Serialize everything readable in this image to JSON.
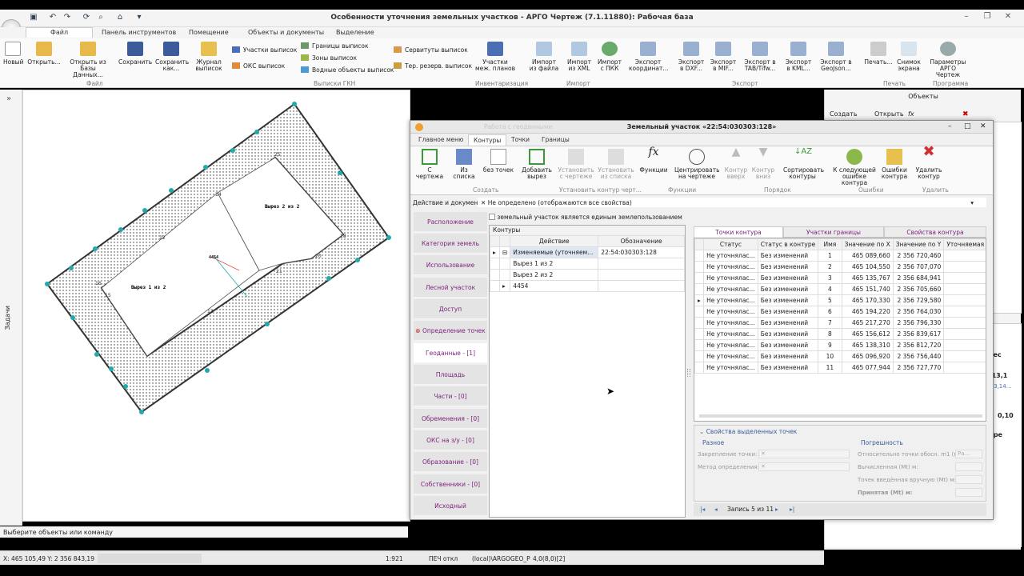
{
  "app": {
    "title": "Особенности уточнения земельных участков - АРГО Чертеж (7.1.11880): Рабочая база"
  },
  "ribbon": {
    "tabs": [
      "Файл",
      "Панель инструментов",
      "Помещение",
      "Объекты и документы",
      "Выделение"
    ],
    "buttons": {
      "new": "Новый",
      "open": "Открыть...",
      "open_db": "Открыть из Базы Данных...",
      "save": "Сохранить",
      "save_as": "Сохранить как...",
      "journal": "Журнал выписок",
      "plans": "Участки меж. планов",
      "import_file": "Импорт из файла",
      "import_xml": "Импорт из XML",
      "import_pkk": "Импорт с ПКК",
      "exp_coord": "Экспорт координат...",
      "exp_dxf": "Экспорт в DXF...",
      "exp_mif": "Экспорт в MIF...",
      "exp_tab": "Экспорт в TAB/Tifw...",
      "exp_kml": "Экспорт в KML...",
      "exp_geojson": "Экспорт в GeoJson...",
      "print": "Печать...",
      "snapshot": "Снимок экрана",
      "params": "Параметры АРГО Чертеж"
    },
    "small": {
      "parcels": "Участки выписок",
      "oks": "ОКС выписок",
      "borders": "Границы выписок",
      "zones": "Зоны выписок",
      "water": "Водные объекты выписок",
      "servitudes": "Сервитуты выписок",
      "reserves": "Тер. резерв. выписок"
    },
    "groups": [
      "Файл",
      "Выписки ГКН",
      "Инвентаризация",
      "Импорт",
      "Экспорт",
      "Печать",
      "Программа"
    ]
  },
  "left_strip": {
    "label": "Задачи"
  },
  "canvas": {
    "label_cut1": "Вырез 1 из 2",
    "label_cut2": "Вырез 2 из 2",
    "label_center": "4454",
    "point_labels": [
      "12",
      "13",
      "14",
      "15",
      "16",
      "18",
      "20",
      "21",
      "25"
    ]
  },
  "status": {
    "prompt": "Выберите объекты или команду",
    "coords": "X: 465 105,49 Y: 2 356 843,19",
    "scale": "1:921",
    "print": "ПЕЧ откл",
    "db": "(local)\\ARGOGEO_P",
    "zoom": "4,0(8,0)[2]"
  },
  "objects_panel": {
    "title": "Объекты",
    "create": "Создать",
    "open": "Открыть",
    "fx": "fx",
    "partial_texts": [
      "квес",
      "1,13,1",
      "1,13,14...",
      "0,10",
      "акре"
    ]
  },
  "dialog": {
    "title": "Земельный участок «22:54:030303:128»",
    "faded_title": "Работа с геоданными",
    "tabs": [
      "Главное меню",
      "Контуры",
      "Точки",
      "Границы"
    ],
    "buttons": {
      "from_drawing": "С чертежа",
      "from_list": "Из списка",
      "no_points": "без точек",
      "add_cut": "Добавить вырез",
      "set_from_drawing": "Установить с чертеже",
      "set_from_list": "Установить из списка",
      "functions": "Функции",
      "center": "Центрировать на чертеже",
      "up": "Контур вверх",
      "down": "Контур вниз",
      "sort": "Сортировать контуры",
      "next_error": "К следующей ошибке контура",
      "errors": "Ошибки контура",
      "delete": "Удалить контур"
    },
    "groups": [
      "Создать",
      "Установить контур черт...",
      "Функции",
      "Порядок",
      "Ошибки",
      "Удалить"
    ],
    "action_label": "Действие и документ:",
    "action_value": "Не определено (отображаются все свойства)",
    "checkbox_label": "земельный участок является единым землепользованием",
    "nav": [
      "Расположение",
      "Категория земель",
      "Использование",
      "Лесной участок",
      "Доступ",
      "Определение точек",
      "Геоданные - [1]",
      "Площадь",
      "Части - [0]",
      "Обременения - [0]",
      "ОКС на з/у - [0]",
      "Образование - [0]",
      "Собственники - [0]",
      "Исходный"
    ],
    "contours": {
      "title": "Контуры",
      "headers": [
        "Действие",
        "Обозначение"
      ],
      "rows": [
        {
          "action": "Изменяемые (уточняем...",
          "designation": "22:54:030303:128"
        },
        {
          "action": "Вырез 1 из 2",
          "designation": ""
        },
        {
          "action": "Вырез 2 из 2",
          "designation": ""
        },
        {
          "action": "4454",
          "designation": ""
        }
      ]
    },
    "right_tabs": [
      "Точки контура",
      "Участки границы",
      "Свойства контура"
    ],
    "points": {
      "headers": [
        "Статус",
        "Статус в контуре",
        "Имя",
        "Значение по X",
        "Значение по Y",
        "Уточняемая т..."
      ],
      "rows": [
        [
          "Не уточнялас...",
          "Без изменений",
          "1",
          "465 089,660",
          "2 356 720,460"
        ],
        [
          "Не уточнялас...",
          "Без изменений",
          "2",
          "465 104,550",
          "2 356 707,070"
        ],
        [
          "Не уточнялас...",
          "Без изменений",
          "3",
          "465 135,767",
          "2 356 684,941"
        ],
        [
          "Не уточнялас...",
          "Без изменений",
          "4",
          "465 151,740",
          "2 356 705,660"
        ],
        [
          "Не уточнялас...",
          "Без изменений",
          "5",
          "465 170,330",
          "2 356 729,580"
        ],
        [
          "Не уточнялас...",
          "Без изменений",
          "6",
          "465 194,220",
          "2 356 764,030"
        ],
        [
          "Не уточнялас...",
          "Без изменений",
          "7",
          "465 217,270",
          "2 356 796,330"
        ],
        [
          "Не уточнялас...",
          "Без изменений",
          "8",
          "465 156,612",
          "2 356 839,617"
        ],
        [
          "Не уточнялас...",
          "Без изменений",
          "9",
          "465 138,310",
          "2 356 812,720"
        ],
        [
          "Не уточнялас...",
          "Без изменений",
          "10",
          "465 096,920",
          "2 356 756,440"
        ],
        [
          "Не уточнялас...",
          "Без изменений",
          "11",
          "465 077,944",
          "2 356 727,770"
        ]
      ]
    },
    "props": {
      "title": "Свойства выделенных точек",
      "misc": "Разное",
      "accuracy": "Погрешность",
      "fix": "Закрепление точки:",
      "method": "Метод определения:",
      "rel": "Относительно точки обосн. m1 (м):",
      "rel_val": "Ра...",
      "calc": "Вычисленная (Mt) м:",
      "manual": "Точек введённая вручную (Mt) м:",
      "accepted": "Принятая (Mt) м:"
    },
    "record": "Запись 5 из 11"
  }
}
